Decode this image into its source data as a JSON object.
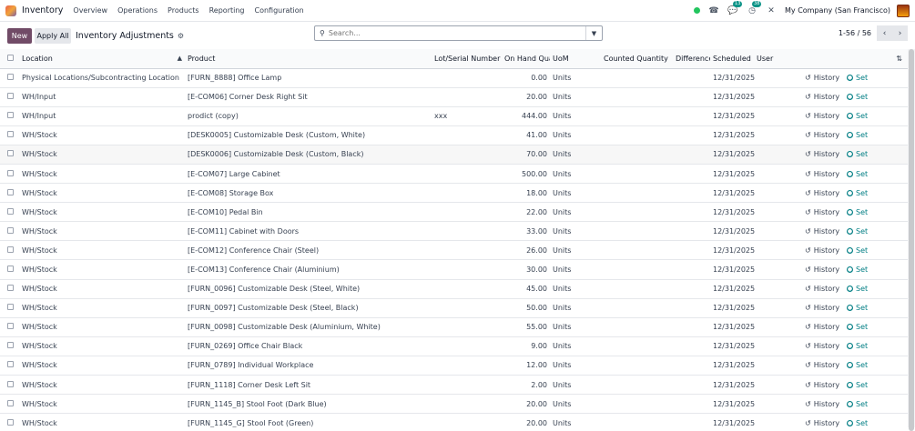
{
  "navbar": {
    "app_name": "Inventory",
    "menu": [
      "Overview",
      "Operations",
      "Products",
      "Reporting",
      "Configuration"
    ],
    "messages_count": "13",
    "activities_count": "38",
    "company": "My Company (San Francisco)"
  },
  "control": {
    "new_label": "New",
    "apply_all_label": "Apply All",
    "title": "Inventory Adjustments",
    "search_placeholder": "Search...",
    "pager": "1-56 / 56"
  },
  "table": {
    "headers": {
      "location": "Location",
      "product": "Product",
      "lot": "Lot/Serial Number",
      "on_hand": "On Hand Quantity",
      "uom": "UoM",
      "counted": "Counted Quantity",
      "difference": "Difference",
      "scheduled": "Scheduled Date",
      "user": "User"
    },
    "history_label": "History",
    "set_label": "Set",
    "rows": [
      {
        "location": "Physical Locations/Subcontracting Location",
        "product": "[FURN_8888] Office Lamp",
        "lot": "",
        "on_hand": "0.00",
        "uom": "Units",
        "date": "12/31/2025"
      },
      {
        "location": "WH/Input",
        "product": "[E-COM06] Corner Desk Right Sit",
        "lot": "",
        "on_hand": "20.00",
        "uom": "Units",
        "date": "12/31/2025"
      },
      {
        "location": "WH/Input",
        "product": "prodict (copy)",
        "lot": "xxx",
        "on_hand": "444.00",
        "uom": "Units",
        "date": "12/31/2025"
      },
      {
        "location": "WH/Stock",
        "product": "[DESK0005] Customizable Desk (Custom, White)",
        "lot": "",
        "on_hand": "41.00",
        "uom": "Units",
        "date": "12/31/2025"
      },
      {
        "location": "WH/Stock",
        "product": "[DESK0006] Customizable Desk (Custom, Black)",
        "lot": "",
        "on_hand": "70.00",
        "uom": "Units",
        "date": "12/31/2025"
      },
      {
        "location": "WH/Stock",
        "product": "[E-COM07] Large Cabinet",
        "lot": "",
        "on_hand": "500.00",
        "uom": "Units",
        "date": "12/31/2025"
      },
      {
        "location": "WH/Stock",
        "product": "[E-COM08] Storage Box",
        "lot": "",
        "on_hand": "18.00",
        "uom": "Units",
        "date": "12/31/2025"
      },
      {
        "location": "WH/Stock",
        "product": "[E-COM10] Pedal Bin",
        "lot": "",
        "on_hand": "22.00",
        "uom": "Units",
        "date": "12/31/2025"
      },
      {
        "location": "WH/Stock",
        "product": "[E-COM11] Cabinet with Doors",
        "lot": "",
        "on_hand": "33.00",
        "uom": "Units",
        "date": "12/31/2025"
      },
      {
        "location": "WH/Stock",
        "product": "[E-COM12] Conference Chair (Steel)",
        "lot": "",
        "on_hand": "26.00",
        "uom": "Units",
        "date": "12/31/2025"
      },
      {
        "location": "WH/Stock",
        "product": "[E-COM13] Conference Chair (Aluminium)",
        "lot": "",
        "on_hand": "30.00",
        "uom": "Units",
        "date": "12/31/2025"
      },
      {
        "location": "WH/Stock",
        "product": "[FURN_0096] Customizable Desk (Steel, White)",
        "lot": "",
        "on_hand": "45.00",
        "uom": "Units",
        "date": "12/31/2025"
      },
      {
        "location": "WH/Stock",
        "product": "[FURN_0097] Customizable Desk (Steel, Black)",
        "lot": "",
        "on_hand": "50.00",
        "uom": "Units",
        "date": "12/31/2025"
      },
      {
        "location": "WH/Stock",
        "product": "[FURN_0098] Customizable Desk (Aluminium, White)",
        "lot": "",
        "on_hand": "55.00",
        "uom": "Units",
        "date": "12/31/2025"
      },
      {
        "location": "WH/Stock",
        "product": "[FURN_0269] Office Chair Black",
        "lot": "",
        "on_hand": "9.00",
        "uom": "Units",
        "date": "12/31/2025"
      },
      {
        "location": "WH/Stock",
        "product": "[FURN_0789] Individual Workplace",
        "lot": "",
        "on_hand": "12.00",
        "uom": "Units",
        "date": "12/31/2025"
      },
      {
        "location": "WH/Stock",
        "product": "[FURN_1118] Corner Desk Left Sit",
        "lot": "",
        "on_hand": "2.00",
        "uom": "Units",
        "date": "12/31/2025"
      },
      {
        "location": "WH/Stock",
        "product": "[FURN_1145_B] Stool Foot (Dark Blue)",
        "lot": "",
        "on_hand": "20.00",
        "uom": "Units",
        "date": "12/31/2025"
      },
      {
        "location": "WH/Stock",
        "product": "[FURN_1145_G] Stool Foot (Green)",
        "lot": "",
        "on_hand": "20.00",
        "uom": "Units",
        "date": "12/31/2025"
      }
    ]
  }
}
